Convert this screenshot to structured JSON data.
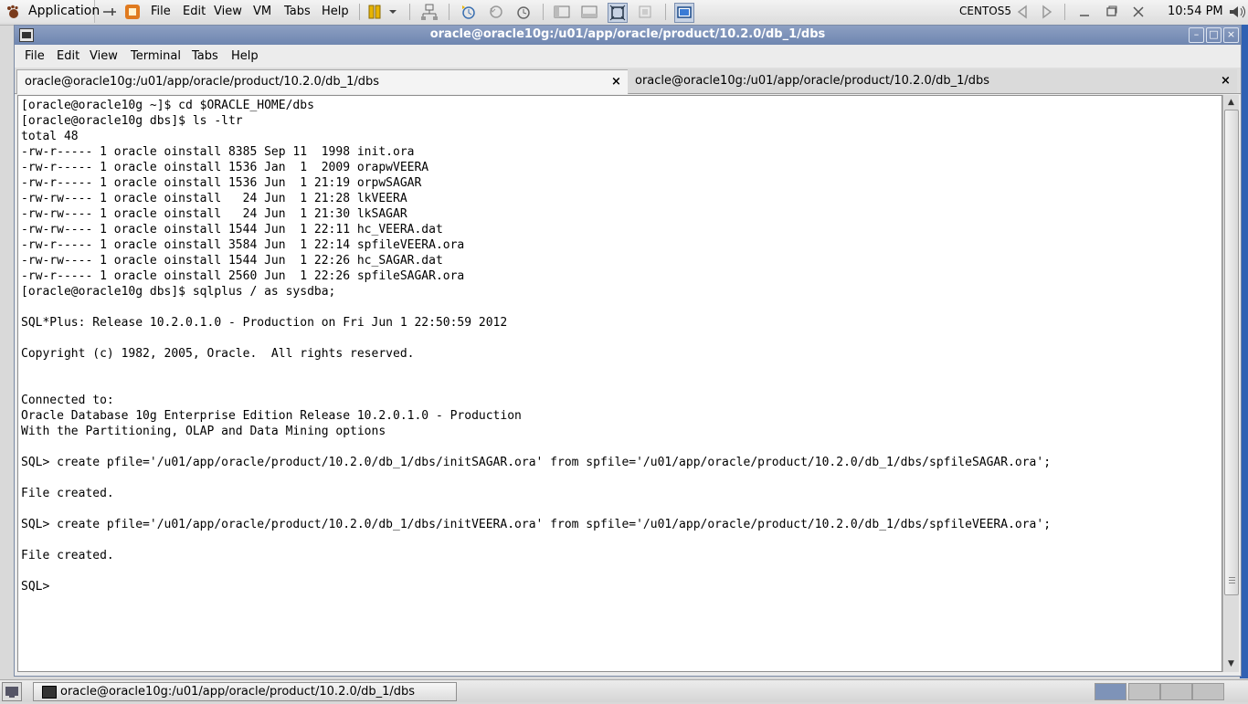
{
  "top_panel": {
    "applications_label": "Application",
    "vm_menus": [
      "File",
      "Edit",
      "View",
      "VM",
      "Tabs",
      "Help"
    ],
    "vm_name": "CENTOS5",
    "clock": "10:54 PM"
  },
  "window": {
    "title": "oracle@oracle10g:/u01/app/oracle/product/10.2.0/db_1/dbs",
    "menu": [
      "File",
      "Edit",
      "View",
      "Terminal",
      "Tabs",
      "Help"
    ],
    "tabs": [
      {
        "label": "oracle@oracle10g:/u01/app/oracle/product/10.2.0/db_1/dbs",
        "active": true
      },
      {
        "label": "oracle@oracle10g:/u01/app/oracle/product/10.2.0/db_1/dbs",
        "active": false
      }
    ],
    "tab_close_glyph": "×"
  },
  "terminal": {
    "lines": [
      "[oracle@oracle10g ~]$ cd $ORACLE_HOME/dbs",
      "[oracle@oracle10g dbs]$ ls -ltr",
      "total 48",
      "-rw-r----- 1 oracle oinstall 8385 Sep 11  1998 init.ora",
      "-rw-r----- 1 oracle oinstall 1536 Jan  1  2009 orapwVEERA",
      "-rw-r----- 1 oracle oinstall 1536 Jun  1 21:19 orpwSAGAR",
      "-rw-rw---- 1 oracle oinstall   24 Jun  1 21:28 lkVEERA",
      "-rw-rw---- 1 oracle oinstall   24 Jun  1 21:30 lkSAGAR",
      "-rw-rw---- 1 oracle oinstall 1544 Jun  1 22:11 hc_VEERA.dat",
      "-rw-r----- 1 oracle oinstall 3584 Jun  1 22:14 spfileVEERA.ora",
      "-rw-rw---- 1 oracle oinstall 1544 Jun  1 22:26 hc_SAGAR.dat",
      "-rw-r----- 1 oracle oinstall 2560 Jun  1 22:26 spfileSAGAR.ora",
      "[oracle@oracle10g dbs]$ sqlplus / as sysdba;",
      "",
      "SQL*Plus: Release 10.2.0.1.0 - Production on Fri Jun 1 22:50:59 2012",
      "",
      "Copyright (c) 1982, 2005, Oracle.  All rights reserved.",
      "",
      "",
      "Connected to:",
      "Oracle Database 10g Enterprise Edition Release 10.2.0.1.0 - Production",
      "With the Partitioning, OLAP and Data Mining options",
      "",
      "SQL> create pfile='/u01/app/oracle/product/10.2.0/db_1/dbs/initSAGAR.ora' from spfile='/u01/app/oracle/product/10.2.0/db_1/dbs/spfileSAGAR.ora';",
      "",
      "File created.",
      "",
      "SQL> create pfile='/u01/app/oracle/product/10.2.0/db_1/dbs/initVEERA.ora' from spfile='/u01/app/oracle/product/10.2.0/db_1/dbs/spfileVEERA.ora';",
      "",
      "File created.",
      "",
      "SQL>"
    ]
  },
  "taskbar": {
    "task_label": "oracle@oracle10g:/u01/app/oracle/product/10.2.0/db_1/dbs"
  },
  "colors": {
    "titlebar": "#7a8fb8",
    "terminal_bg": "#ffffff",
    "desktop": "#2f61b3"
  }
}
